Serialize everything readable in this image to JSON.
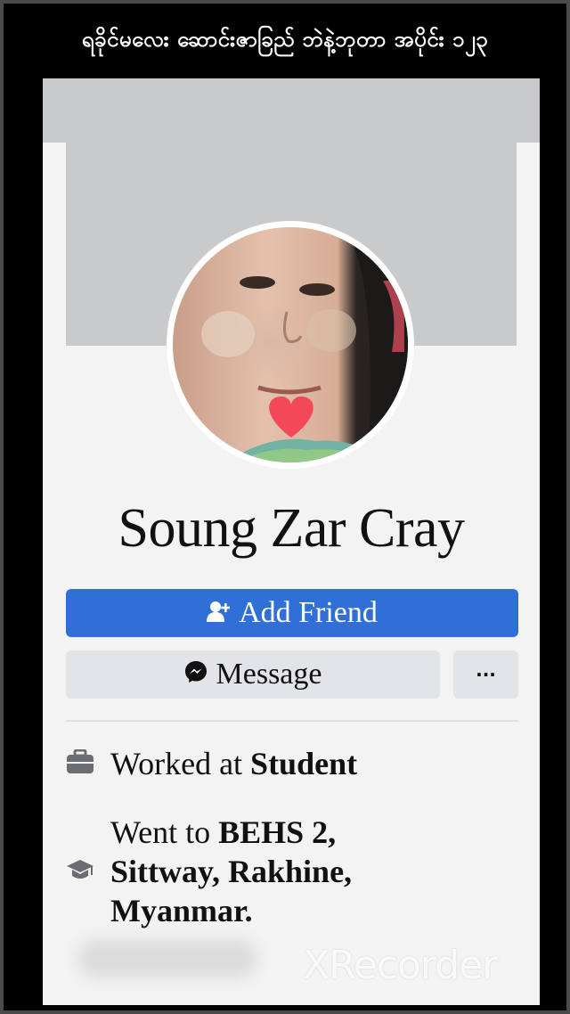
{
  "caption": "ရခိုင်မလေး ဆောင်းဇာခြည် ဘဲနဲ့ဘုတာ အပိုင်း ၁၂၃",
  "profile": {
    "name": "Soung Zar Cray"
  },
  "actions": {
    "add_friend_label": "Add Friend",
    "message_label": "Message",
    "more_label": "···"
  },
  "about": {
    "work_prefix": "Worked at ",
    "work_place": "Student",
    "edu_prefix": "Went to ",
    "edu_place": "BEHS 2, Sittway, Rakhine, Myanmar."
  },
  "watermark": "XRecorder",
  "colors": {
    "accent": "#2f6fd6",
    "secondary_button": "#e3e4e8",
    "cover": "#c9cacc"
  },
  "icons": {
    "add_friend": "person-plus-icon",
    "message": "messenger-icon",
    "work": "briefcase-icon",
    "education": "graduation-cap-icon",
    "avatar_overlay": "heart-icon"
  }
}
